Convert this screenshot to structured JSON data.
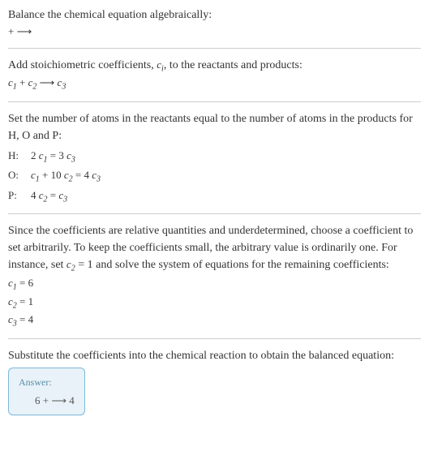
{
  "step1": {
    "text": "Balance the chemical equation algebraically:",
    "equation": " +  ⟶ "
  },
  "step2": {
    "text_before": "Add stoichiometric coefficients, ",
    "ci": "c",
    "ci_sub": "i",
    "text_after": ", to the reactants and products:",
    "equation_c1": "c",
    "equation_c1_sub": "1",
    "equation_plus": "  + ",
    "equation_c2": "c",
    "equation_c2_sub": "2",
    "equation_arrow": "   ⟶ ",
    "equation_c3": "c",
    "equation_c3_sub": "3"
  },
  "step3": {
    "text": "Set the number of atoms in the reactants equal to the number of atoms in the products for H, O and P:",
    "rows": [
      {
        "label": "H: ",
        "lhs_coef": "2 ",
        "lhs_c": "c",
        "lhs_sub": "1",
        "eq": " = 3 ",
        "rhs_c": "c",
        "rhs_sub": "3"
      },
      {
        "label": "O: ",
        "lhs_c1": "c",
        "lhs_sub1": "1",
        "plus": " + 10 ",
        "lhs_c2": "c",
        "lhs_sub2": "2",
        "eq": " = 4 ",
        "rhs_c": "c",
        "rhs_sub": "3"
      },
      {
        "label": "P: ",
        "lhs_coef": "4 ",
        "lhs_c": "c",
        "lhs_sub": "2",
        "eq": " = ",
        "rhs_c": "c",
        "rhs_sub": "3"
      }
    ]
  },
  "step4": {
    "text_before": "Since the coefficients are relative quantities and underdetermined, choose a coefficient to set arbitrarily. To keep the coefficients small, the arbitrary value is ordinarily one. For instance, set ",
    "c2": "c",
    "c2_sub": "2",
    "text_after": " = 1 and solve the system of equations for the remaining coefficients:",
    "solutions": [
      {
        "c": "c",
        "sub": "1",
        "val": " = 6"
      },
      {
        "c": "c",
        "sub": "2",
        "val": " = 1"
      },
      {
        "c": "c",
        "sub": "3",
        "val": " = 4"
      }
    ]
  },
  "step5": {
    "text": "Substitute the coefficients into the chemical reaction to obtain the balanced equation:"
  },
  "answer": {
    "label": "Answer:",
    "content": "6  +  ⟶ 4 "
  }
}
